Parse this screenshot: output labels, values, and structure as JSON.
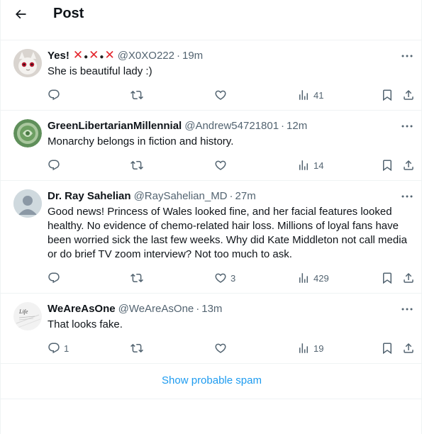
{
  "header": {
    "title": "Post"
  },
  "replies": [
    {
      "name": "Yes!",
      "handle": "@X0XO222",
      "time": "19m",
      "text": "She is beautiful lady :)",
      "actions": {
        "replies": "",
        "reposts": "",
        "likes": "",
        "views": "41"
      }
    },
    {
      "name": "GreenLibertarianMillennial",
      "handle": "@Andrew54721801",
      "time": "12m",
      "text": "Monarchy belongs in fiction and history.",
      "actions": {
        "replies": "",
        "reposts": "",
        "likes": "",
        "views": "14"
      }
    },
    {
      "name": "Dr. Ray Sahelian",
      "handle": "@RaySahelian_MD",
      "time": "27m",
      "text": "Good news! Princess of Wales looked fine, and her facial features looked healthy. No evidence of chemo-related hair loss. Millions of loyal fans have been worried sick the last few weeks. Why did Kate Middleton not call media or do brief TV zoom interview? Not too much to ask.",
      "actions": {
        "replies": "",
        "reposts": "",
        "likes": "3",
        "views": "429"
      }
    },
    {
      "name": "WeAreAsOne",
      "handle": "@WeAreAsOne",
      "time": "13m",
      "text": "That looks fake.",
      "actions": {
        "replies": "1",
        "reposts": "",
        "likes": "",
        "views": "19"
      }
    }
  ],
  "spam_link": "Show probable spam",
  "separator": "·",
  "avatar_texts": {
    "r3": "Life"
  },
  "colors": {
    "accent": "#1d9bf0",
    "secondary_text": "#536471",
    "border": "#eff3f4",
    "emoji_red": "#e3242b"
  }
}
